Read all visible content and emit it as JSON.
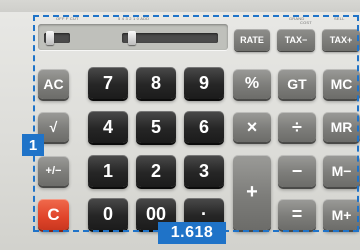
{
  "labels": {
    "tiny_left": "OFF F CUT",
    "tiny_mid": "5 4 3 2 1 0 ADD",
    "tiny_gt": "GRAND",
    "tiny_cost": "COST",
    "tiny_sell": "SELL"
  },
  "top_keys": [
    "RATE",
    "TAX−",
    "TAX+"
  ],
  "keys": {
    "ac": "AC",
    "sqrt": "√",
    "plusminus": "+/−",
    "c": "C",
    "d7": "7",
    "d8": "8",
    "d9": "9",
    "d4": "4",
    "d5": "5",
    "d6": "6",
    "d1": "1",
    "d2": "2",
    "d3": "3",
    "d0": "0",
    "d00": "00",
    "dot": "·",
    "percent": "%",
    "times": "×",
    "plus": "+",
    "gt": "GT",
    "divide": "÷",
    "minus": "−",
    "equals": "=",
    "mc": "MC",
    "mr": "MR",
    "mminus": "M−",
    "mplus": "M+"
  },
  "callouts": {
    "side": "1",
    "bottom": "1.618"
  },
  "colors": {
    "callout": "#1f73c8",
    "clear_key": "#e0442a"
  }
}
